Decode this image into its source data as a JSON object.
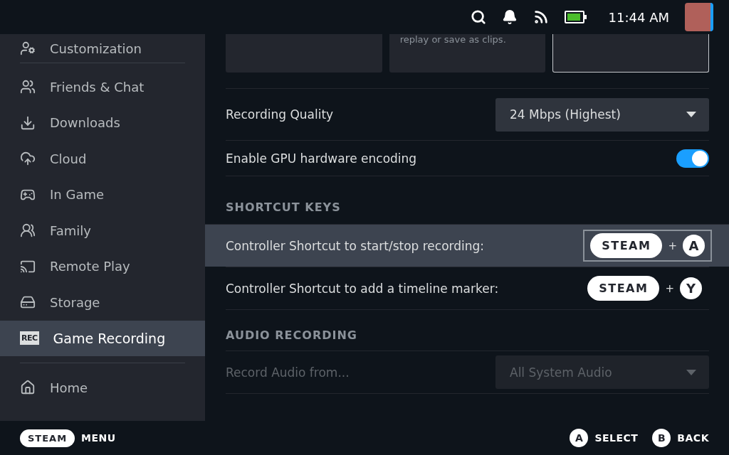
{
  "top_bar": {
    "time": "11:44 AM"
  },
  "sidebar": {
    "groups": [
      [
        {
          "label": "Customization",
          "selected": false
        }
      ],
      [
        {
          "label": "Friends & Chat",
          "selected": false
        },
        {
          "label": "Downloads",
          "selected": false
        },
        {
          "label": "Cloud",
          "selected": false
        },
        {
          "label": "In Game",
          "selected": false
        },
        {
          "label": "Family",
          "selected": false
        },
        {
          "label": "Remote Play",
          "selected": false
        },
        {
          "label": "Storage",
          "selected": false
        },
        {
          "label": "Game Recording",
          "selected": true,
          "badge": "REC"
        }
      ],
      [
        {
          "label": "Home",
          "selected": false
        }
      ]
    ]
  },
  "cards": [
    {
      "selected": false
    },
    {
      "text": "replay or save as clips.",
      "selected": false
    },
    {
      "selected": true
    }
  ],
  "settings": [
    {
      "kind": "dropdown",
      "label": "Recording Quality",
      "value": "24 Mbps (Highest)",
      "disabled": false
    },
    {
      "kind": "toggle",
      "label": "Enable GPU hardware encoding",
      "on": true
    },
    {
      "kind": "header",
      "label": "SHORTCUT KEYS"
    },
    {
      "kind": "shortcut",
      "label": "Controller Shortcut to start/stop recording:",
      "selected": true,
      "keys": [
        {
          "kind": "pill",
          "label": "STEAM"
        },
        {
          "kind": "plus",
          "label": "+"
        },
        {
          "kind": "circle",
          "label": "A"
        }
      ]
    },
    {
      "kind": "shortcut",
      "label": "Controller Shortcut to add a timeline marker:",
      "selected": false,
      "keys": [
        {
          "kind": "pill",
          "label": "STEAM"
        },
        {
          "kind": "plus",
          "label": "+"
        },
        {
          "kind": "circle",
          "label": "Y"
        }
      ]
    },
    {
      "kind": "header",
      "label": "AUDIO RECORDING"
    },
    {
      "kind": "dropdown",
      "label": "Record Audio from...",
      "value": "All System Audio",
      "disabled": true
    }
  ],
  "footer": {
    "left": [
      {
        "button": "STEAM",
        "label": "MENU"
      }
    ],
    "right": [
      {
        "button": "A",
        "label": "SELECT"
      },
      {
        "button": "B",
        "label": "BACK"
      }
    ]
  }
}
